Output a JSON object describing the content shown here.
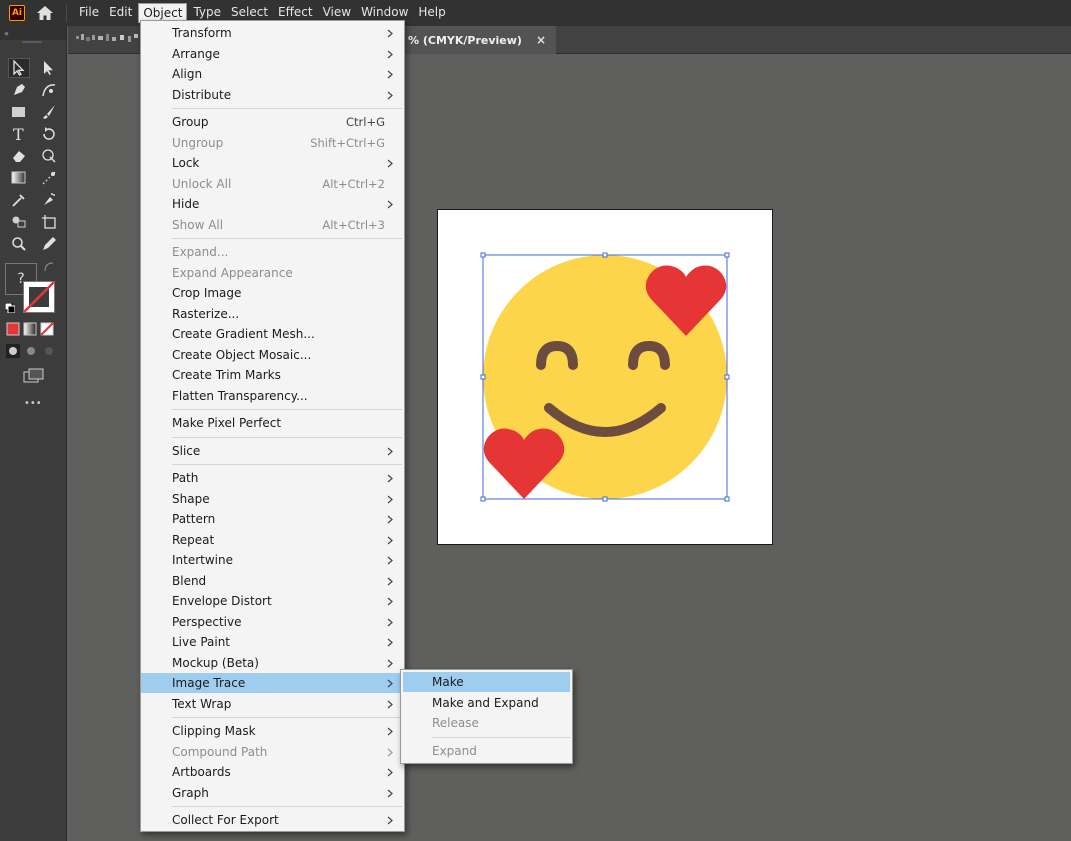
{
  "app": {
    "logo_text": "Ai"
  },
  "menubar": {
    "items": [
      {
        "label": "File"
      },
      {
        "label": "Edit"
      },
      {
        "label": "Object",
        "active": true
      },
      {
        "label": "Type"
      },
      {
        "label": "Select"
      },
      {
        "label": "Effect"
      },
      {
        "label": "View"
      },
      {
        "label": "Window"
      },
      {
        "label": "Help"
      }
    ]
  },
  "document": {
    "tab_title": "% (CMYK/Preview)",
    "close_glyph": "×"
  },
  "colors": {
    "face": "#fdd54a",
    "eyes_mouth": "#6b4c3f",
    "heart": "#e63535",
    "selection": "#3d6bd6",
    "menu_highlight": "#9fcdf0"
  },
  "tools": {
    "unknown_tool": "?",
    "more": "•••"
  },
  "object_menu": {
    "items": [
      {
        "label": "Transform",
        "arrow": true
      },
      {
        "label": "Arrange",
        "arrow": true
      },
      {
        "label": "Align",
        "arrow": true
      },
      {
        "label": "Distribute",
        "arrow": true
      },
      {
        "separator": true
      },
      {
        "label": "Group",
        "shortcut": "Ctrl+G"
      },
      {
        "label": "Ungroup",
        "shortcut": "Shift+Ctrl+G",
        "disabled": true
      },
      {
        "label": "Lock",
        "arrow": true
      },
      {
        "label": "Unlock All",
        "shortcut": "Alt+Ctrl+2",
        "disabled": true
      },
      {
        "label": "Hide",
        "arrow": true
      },
      {
        "label": "Show All",
        "shortcut": "Alt+Ctrl+3",
        "disabled": true
      },
      {
        "separator": true
      },
      {
        "label": "Expand...",
        "disabled": true
      },
      {
        "label": "Expand Appearance",
        "disabled": true
      },
      {
        "label": "Crop Image"
      },
      {
        "label": "Rasterize..."
      },
      {
        "label": "Create Gradient Mesh..."
      },
      {
        "label": "Create Object Mosaic..."
      },
      {
        "label": "Create Trim Marks"
      },
      {
        "label": "Flatten Transparency..."
      },
      {
        "separator": true
      },
      {
        "label": "Make Pixel Perfect"
      },
      {
        "separator": true
      },
      {
        "label": "Slice",
        "arrow": true
      },
      {
        "separator": true
      },
      {
        "label": "Path",
        "arrow": true
      },
      {
        "label": "Shape",
        "arrow": true
      },
      {
        "label": "Pattern",
        "arrow": true
      },
      {
        "label": "Repeat",
        "arrow": true
      },
      {
        "label": "Intertwine",
        "arrow": true
      },
      {
        "label": "Blend",
        "arrow": true
      },
      {
        "label": "Envelope Distort",
        "arrow": true
      },
      {
        "label": "Perspective",
        "arrow": true
      },
      {
        "label": "Live Paint",
        "arrow": true
      },
      {
        "label": "Mockup (Beta)",
        "arrow": true
      },
      {
        "label": "Image Trace",
        "arrow": true,
        "highlighted": true
      },
      {
        "label": "Text Wrap",
        "arrow": true
      },
      {
        "separator": true
      },
      {
        "label": "Clipping Mask",
        "arrow": true
      },
      {
        "label": "Compound Path",
        "arrow": true,
        "disabled": true
      },
      {
        "label": "Artboards",
        "arrow": true
      },
      {
        "label": "Graph",
        "arrow": true
      },
      {
        "separator": true
      },
      {
        "label": "Collect For Export",
        "arrow": true
      }
    ]
  },
  "image_trace_submenu": {
    "items": [
      {
        "label": "Make",
        "highlighted": true
      },
      {
        "label": "Make and Expand"
      },
      {
        "label": "Release",
        "disabled": true
      },
      {
        "separator": true
      },
      {
        "label": "Expand",
        "disabled": true
      }
    ]
  }
}
